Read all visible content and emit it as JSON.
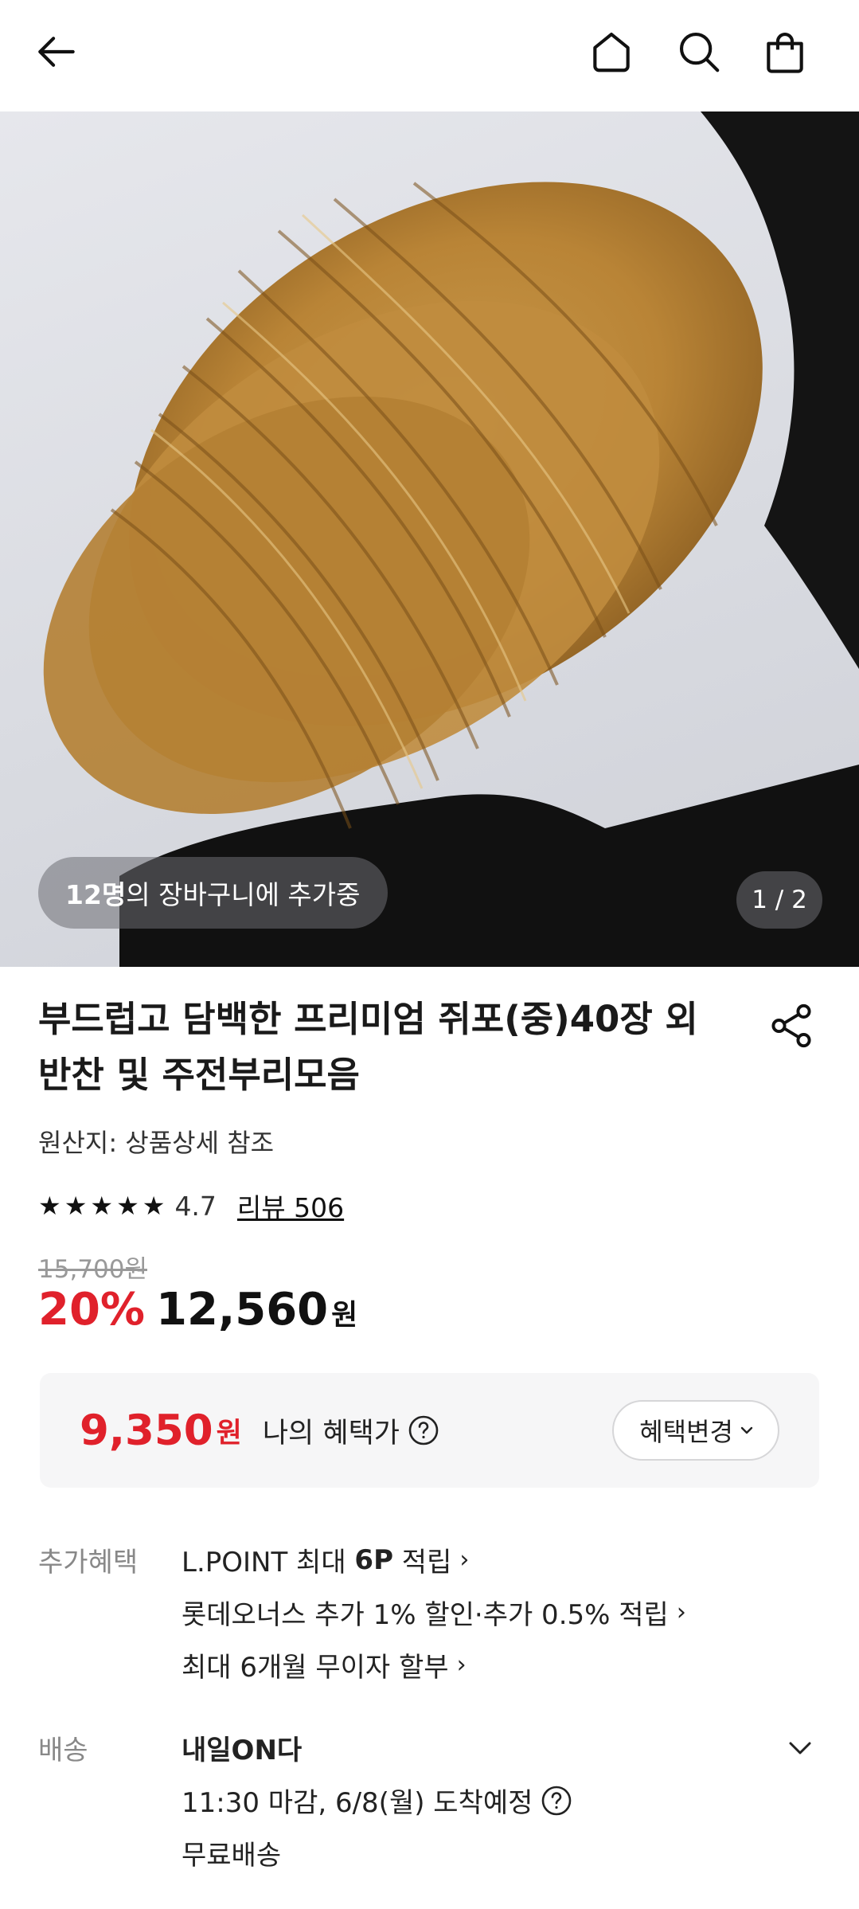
{
  "header": {
    "back_icon": "back-arrow-icon",
    "home_icon": "home-icon",
    "search_icon": "search-icon",
    "cart_icon": "shopping-bag-icon"
  },
  "gallery": {
    "cart_count": "12명",
    "cart_suffix": "의 장바구니에 추가중",
    "page_indicator": "1 / 2"
  },
  "product": {
    "title_line1": "부드럽고 담백한 프리미엄 쥐포(중)40장 외",
    "title_line2": "반찬 및 주전부리모음",
    "origin": "원산지: 상품상세 참조",
    "rating": "4.7",
    "rating_value": 4.7,
    "rating_max": 5,
    "review_link": "리뷰 506",
    "original_price": "15,700원",
    "discount": "20%",
    "price": "12,560",
    "currency": "원"
  },
  "benefit": {
    "price": "9,350",
    "currency": "원",
    "label": "나의 혜택가",
    "change_button": "혜택변경"
  },
  "extra_benefits": {
    "label": "추가혜택",
    "item1_prefix": "L.POINT 최대 ",
    "item1_bold": "6P",
    "item1_suffix": " 적립",
    "item2": "롯데오너스 추가 1% 할인·추가 0.5% 적립",
    "item3": "최대 6개월 무이자 할부"
  },
  "delivery": {
    "label": "배송",
    "title": "내일ON다",
    "eta": "11:30 마감, 6/8(월) 도착예정",
    "fee": "무료배송"
  },
  "colors": {
    "accent_red": "#e0212b",
    "text": "#1a1a1a",
    "muted": "#888888"
  }
}
